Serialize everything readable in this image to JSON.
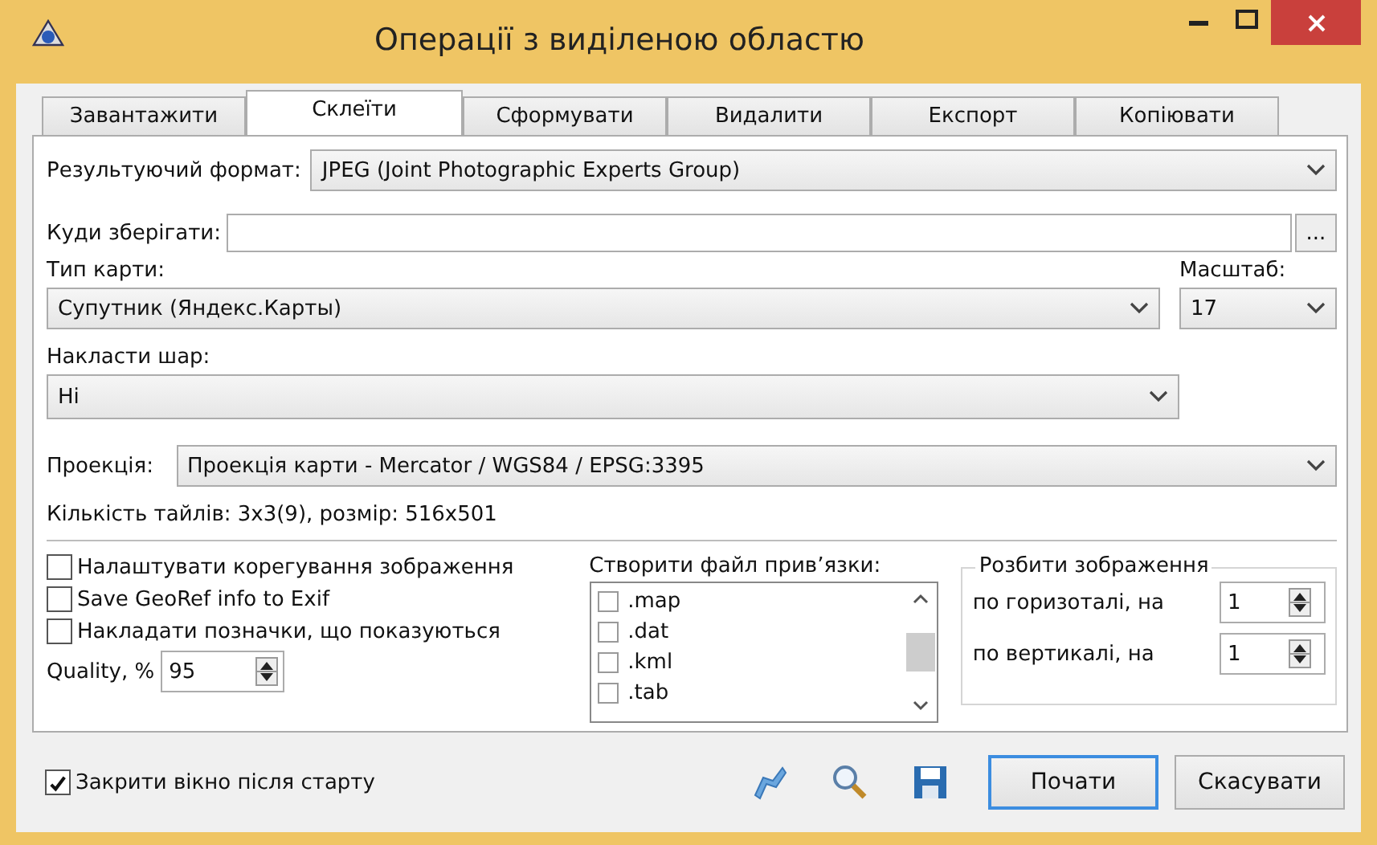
{
  "window": {
    "title": "Операції з виділеною областю"
  },
  "tabs": [
    {
      "label": "Завантажити",
      "selected": false
    },
    {
      "label": "Склеїти",
      "selected": true
    },
    {
      "label": "Сформувати",
      "selected": false
    },
    {
      "label": "Видалити",
      "selected": false
    },
    {
      "label": "Експорт",
      "selected": false
    },
    {
      "label": "Копіювати",
      "selected": false
    }
  ],
  "format": {
    "label": "Результуючий формат:",
    "value": "JPEG (Joint Photographic Experts Group)"
  },
  "save_to": {
    "label": "Куди зберігати:",
    "browse": "..."
  },
  "map_type": {
    "label": "Тип карти:",
    "value": "Супутник (Яндекс.Карты)"
  },
  "scale": {
    "label": "Масштаб:",
    "value": "17"
  },
  "layer": {
    "label": "Накласти шар:",
    "value": "Ні"
  },
  "projection": {
    "label": "Проекція:",
    "value": "Проекція карти - Mercator / WGS84 / EPSG:3395"
  },
  "tiles_info": "Кількість тайлів: 3x3(9), розмір: 516x501",
  "options": [
    {
      "label": "Налаштувати корегування зображення",
      "checked": false
    },
    {
      "label": "Save GeoRef info to Exif",
      "checked": false
    },
    {
      "label": "Накладати позначки, що показуються",
      "checked": false
    }
  ],
  "quality": {
    "label": "Quality, %",
    "value": "95"
  },
  "georef": {
    "label": "Створити файл прив’язки:",
    "items": [
      {
        "label": ".map",
        "checked": false
      },
      {
        "label": ".dat",
        "checked": false
      },
      {
        "label": ".kml",
        "checked": false
      },
      {
        "label": ".tab",
        "checked": false
      }
    ]
  },
  "split": {
    "title": "Розбити зображення",
    "rows": [
      {
        "label": "по горизоталі, на",
        "value": "1"
      },
      {
        "label": "по вертикалі, на",
        "value": "1"
      }
    ]
  },
  "close_after_start": {
    "label": "Закрити вікно після старту",
    "checked": true
  },
  "buttons": [
    {
      "label": "Почати",
      "default": true
    },
    {
      "label": "Скасувати",
      "default": false
    }
  ]
}
